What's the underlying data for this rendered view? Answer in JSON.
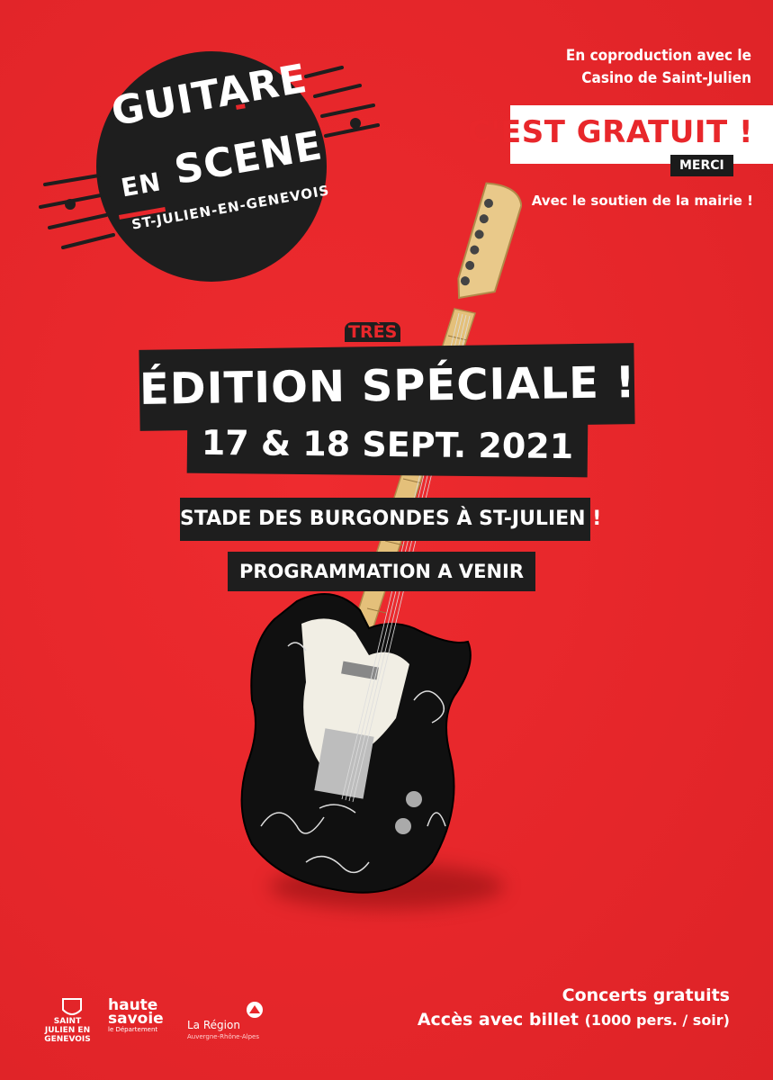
{
  "logo": {
    "line1": "GUITARE",
    "line2a": "EN",
    "line2b": "SCENE",
    "line3": "ST-JULIEN-EN-GENEVOIS"
  },
  "coproduction": {
    "line1": "En coproduction avec le",
    "line2": "Casino de Saint-Julien"
  },
  "gratuit": "C'EST GRATUIT !",
  "merci": "MERCI",
  "soutien": "Avec le soutien de la mairie !",
  "headline": {
    "tres": "TRÈS",
    "edition": "ÉDITION SPÉCIALE !",
    "date": "17 & 18 SEPT. 2021",
    "lieu": "STADE DES BURGONDES À ST-JULIEN !",
    "programmation": "PROGRAMMATION A VENIR"
  },
  "footer": {
    "concerts": "Concerts gratuits",
    "acces": "Accès avec billet",
    "acces_detail": "(1000 pers. / soir)"
  },
  "sponsors": {
    "stjulien": "SAINT JULIEN EN GENEVOIS",
    "hautesavoie_1": "haute",
    "hautesavoie_2": "savoie",
    "hautesavoie_3": "le Département",
    "region": "La Région",
    "region_sub": "Auvergne-Rhône-Alpes"
  },
  "colors": {
    "background": "#e8272b",
    "bar": "#1e1e1e",
    "text": "#ffffff"
  }
}
